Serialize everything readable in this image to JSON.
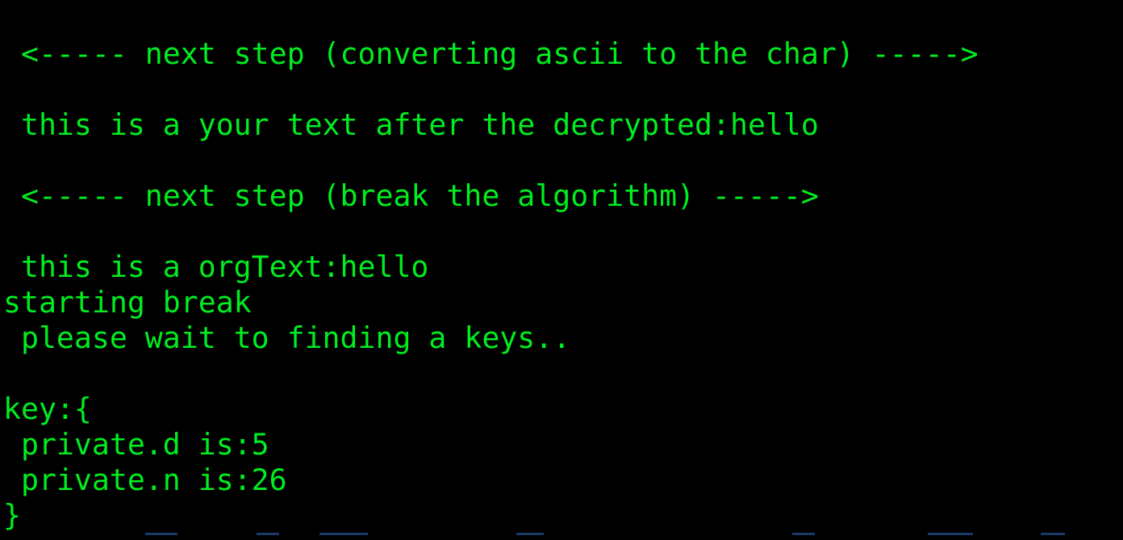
{
  "terminal": {
    "lines": [
      " <----- next step (converting ascii to the char) ----->",
      " this is a your text after the decrypted:hello",
      " <----- next step (break the algorithm) ----->",
      " this is a orgText:hello",
      "starting break",
      " please wait to finding a keys..",
      "key:{",
      " private.d is:5",
      " private.n is:26",
      "}"
    ],
    "text_color": "#00ee20",
    "background_color": "#000000"
  }
}
